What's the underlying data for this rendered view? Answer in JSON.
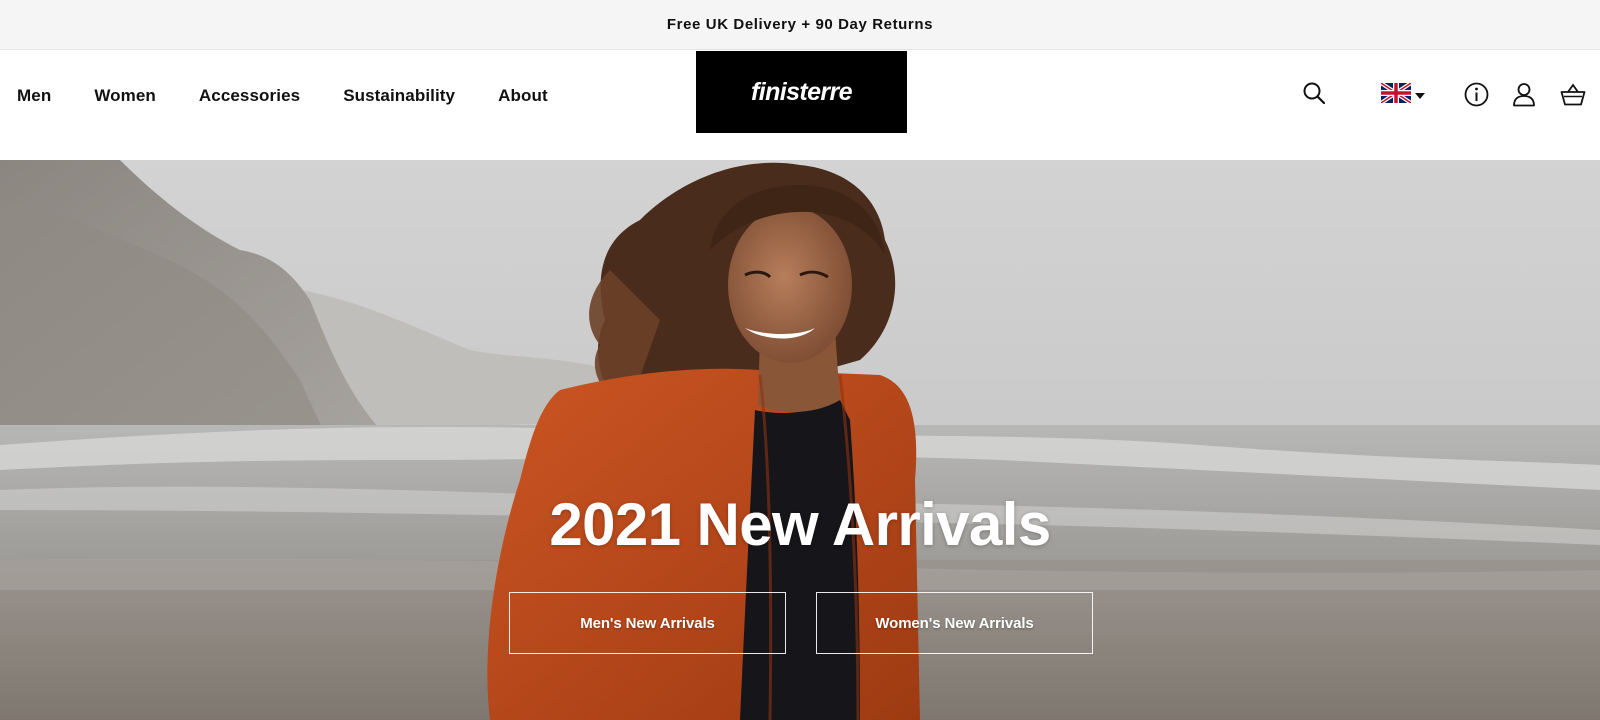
{
  "announcement": "Free UK Delivery + 90 Day Returns",
  "nav": {
    "items": [
      {
        "label": "Men"
      },
      {
        "label": "Women"
      },
      {
        "label": "Accessories"
      },
      {
        "label": "Sustainability"
      },
      {
        "label": "About"
      }
    ]
  },
  "logo": {
    "text": "finisterre"
  },
  "header_icons": [
    "search-icon",
    "uk-flag-icon",
    "caret-down-icon",
    "info-icon",
    "account-icon",
    "basket-icon"
  ],
  "hero": {
    "title": "2021 New Arrivals",
    "buttons": [
      {
        "label": "Men's New Arrivals"
      },
      {
        "label": "Women's New Arrivals"
      }
    ]
  },
  "colors": {
    "announcement_bg": "#f5f5f5",
    "logo_bg": "#000000",
    "text": "#111111",
    "cardigan": "#c8501d"
  }
}
